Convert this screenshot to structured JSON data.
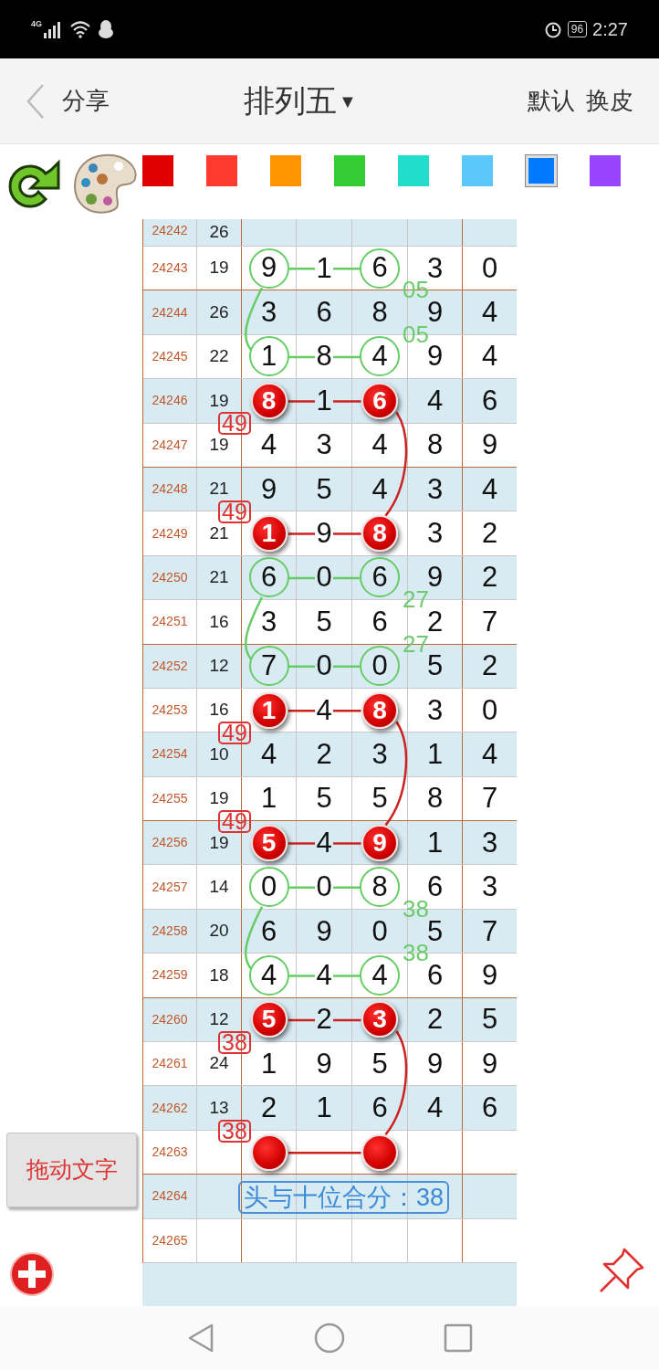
{
  "status_bar": {
    "network": "4G",
    "battery": "96",
    "time": "2:27"
  },
  "header": {
    "back_label": "分享",
    "title": "排列五",
    "title_caret": "▼",
    "actions": [
      "默认",
      "换皮"
    ]
  },
  "palette": {
    "swatches": [
      {
        "color": "#e00000",
        "selected": false
      },
      {
        "color": "#ff3b30",
        "selected": false
      },
      {
        "color": "#ff9500",
        "selected": false
      },
      {
        "color": "#33cc33",
        "selected": false
      },
      {
        "color": "#22ddcc",
        "selected": false
      },
      {
        "color": "#5ac8fa",
        "selected": false
      },
      {
        "color": "#007aff",
        "selected": true
      },
      {
        "color": "#9944ff",
        "selected": false
      }
    ]
  },
  "table": {
    "clipped_row": {
      "issue": "24242",
      "sum": "26"
    },
    "rows": [
      {
        "kind": "ring",
        "issue": "24243",
        "sum": "19",
        "digits": [
          {
            "v": "9",
            "marked": true
          },
          {
            "v": "1",
            "marked": false
          },
          {
            "v": "6",
            "marked": true
          },
          {
            "v": "3",
            "marked": false
          },
          {
            "v": "0",
            "marked": false
          }
        ],
        "tag": {
          "kind": "green_text",
          "text": "05"
        }
      },
      {
        "kind": "plain",
        "issue": "24244",
        "sum": "26",
        "digits": [
          {
            "v": "3",
            "marked": false
          },
          {
            "v": "6",
            "marked": false
          },
          {
            "v": "8",
            "marked": false
          },
          {
            "v": "9",
            "marked": false
          },
          {
            "v": "4",
            "marked": false
          }
        ],
        "tag": {
          "kind": "green_text",
          "text": "05"
        }
      },
      {
        "kind": "ring",
        "issue": "24245",
        "sum": "22",
        "digits": [
          {
            "v": "1",
            "marked": true
          },
          {
            "v": "8",
            "marked": false
          },
          {
            "v": "4",
            "marked": true
          },
          {
            "v": "9",
            "marked": false
          },
          {
            "v": "4",
            "marked": false
          }
        ]
      },
      {
        "kind": "ball",
        "issue": "24246",
        "sum": "19",
        "digits": [
          {
            "v": "8",
            "marked": true
          },
          {
            "v": "1",
            "marked": false
          },
          {
            "v": "6",
            "marked": true
          },
          {
            "v": "4",
            "marked": false
          },
          {
            "v": "6",
            "marked": false
          }
        ]
      },
      {
        "kind": "plain",
        "issue": "24247",
        "sum": "19",
        "digits": [
          {
            "v": "4",
            "marked": false
          },
          {
            "v": "3",
            "marked": false
          },
          {
            "v": "4",
            "marked": false
          },
          {
            "v": "8",
            "marked": false
          },
          {
            "v": "9",
            "marked": false
          }
        ],
        "tag": {
          "kind": "red_box",
          "text": "49"
        }
      },
      {
        "kind": "plain",
        "issue": "24248",
        "sum": "21",
        "digits": [
          {
            "v": "9",
            "marked": false
          },
          {
            "v": "5",
            "marked": false
          },
          {
            "v": "4",
            "marked": false
          },
          {
            "v": "3",
            "marked": false
          },
          {
            "v": "4",
            "marked": false
          }
        ]
      },
      {
        "kind": "ball",
        "issue": "24249",
        "sum": "21",
        "digits": [
          {
            "v": "1",
            "marked": true
          },
          {
            "v": "9",
            "marked": false
          },
          {
            "v": "8",
            "marked": true
          },
          {
            "v": "3",
            "marked": false
          },
          {
            "v": "2",
            "marked": false
          }
        ],
        "tag": {
          "kind": "red_box",
          "text": "49"
        }
      },
      {
        "kind": "ring",
        "issue": "24250",
        "sum": "21",
        "digits": [
          {
            "v": "6",
            "marked": true
          },
          {
            "v": "0",
            "marked": false
          },
          {
            "v": "6",
            "marked": true
          },
          {
            "v": "9",
            "marked": false
          },
          {
            "v": "2",
            "marked": false
          }
        ],
        "tag": {
          "kind": "green_text",
          "text": "27"
        }
      },
      {
        "kind": "plain",
        "issue": "24251",
        "sum": "16",
        "digits": [
          {
            "v": "3",
            "marked": false
          },
          {
            "v": "5",
            "marked": false
          },
          {
            "v": "6",
            "marked": false
          },
          {
            "v": "2",
            "marked": false
          },
          {
            "v": "7",
            "marked": false
          }
        ],
        "tag": {
          "kind": "green_text",
          "text": "27"
        }
      },
      {
        "kind": "ring",
        "issue": "24252",
        "sum": "12",
        "digits": [
          {
            "v": "7",
            "marked": true
          },
          {
            "v": "0",
            "marked": false
          },
          {
            "v": "0",
            "marked": true
          },
          {
            "v": "5",
            "marked": false
          },
          {
            "v": "2",
            "marked": false
          }
        ]
      },
      {
        "kind": "ball",
        "issue": "24253",
        "sum": "16",
        "digits": [
          {
            "v": "1",
            "marked": true
          },
          {
            "v": "4",
            "marked": false
          },
          {
            "v": "8",
            "marked": true
          },
          {
            "v": "3",
            "marked": false
          },
          {
            "v": "0",
            "marked": false
          }
        ]
      },
      {
        "kind": "plain",
        "issue": "24254",
        "sum": "10",
        "digits": [
          {
            "v": "4",
            "marked": false
          },
          {
            "v": "2",
            "marked": false
          },
          {
            "v": "3",
            "marked": false
          },
          {
            "v": "1",
            "marked": false
          },
          {
            "v": "4",
            "marked": false
          }
        ],
        "tag": {
          "kind": "red_box",
          "text": "49"
        }
      },
      {
        "kind": "plain",
        "issue": "24255",
        "sum": "19",
        "digits": [
          {
            "v": "1",
            "marked": false
          },
          {
            "v": "5",
            "marked": false
          },
          {
            "v": "5",
            "marked": false
          },
          {
            "v": "8",
            "marked": false
          },
          {
            "v": "7",
            "marked": false
          }
        ]
      },
      {
        "kind": "ball",
        "issue": "24256",
        "sum": "19",
        "digits": [
          {
            "v": "5",
            "marked": true
          },
          {
            "v": "4",
            "marked": false
          },
          {
            "v": "9",
            "marked": true
          },
          {
            "v": "1",
            "marked": false
          },
          {
            "v": "3",
            "marked": false
          }
        ],
        "tag": {
          "kind": "red_box",
          "text": "49"
        }
      },
      {
        "kind": "ring",
        "issue": "24257",
        "sum": "14",
        "digits": [
          {
            "v": "0",
            "marked": true
          },
          {
            "v": "0",
            "marked": false
          },
          {
            "v": "8",
            "marked": true
          },
          {
            "v": "6",
            "marked": false
          },
          {
            "v": "3",
            "marked": false
          }
        ],
        "tag": {
          "kind": "green_text",
          "text": "38"
        }
      },
      {
        "kind": "plain",
        "issue": "24258",
        "sum": "20",
        "digits": [
          {
            "v": "6",
            "marked": false
          },
          {
            "v": "9",
            "marked": false
          },
          {
            "v": "0",
            "marked": false
          },
          {
            "v": "5",
            "marked": false
          },
          {
            "v": "7",
            "marked": false
          }
        ],
        "tag": {
          "kind": "green_text",
          "text": "38"
        }
      },
      {
        "kind": "ring",
        "issue": "24259",
        "sum": "18",
        "digits": [
          {
            "v": "4",
            "marked": true
          },
          {
            "v": "4",
            "marked": false
          },
          {
            "v": "4",
            "marked": true
          },
          {
            "v": "6",
            "marked": false
          },
          {
            "v": "9",
            "marked": false
          }
        ]
      },
      {
        "kind": "ball",
        "issue": "24260",
        "sum": "12",
        "digits": [
          {
            "v": "5",
            "marked": true
          },
          {
            "v": "2",
            "marked": false
          },
          {
            "v": "3",
            "marked": true
          },
          {
            "v": "2",
            "marked": false
          },
          {
            "v": "5",
            "marked": false
          }
        ]
      },
      {
        "kind": "plain",
        "issue": "24261",
        "sum": "24",
        "digits": [
          {
            "v": "1",
            "marked": false
          },
          {
            "v": "9",
            "marked": false
          },
          {
            "v": "5",
            "marked": false
          },
          {
            "v": "9",
            "marked": false
          },
          {
            "v": "9",
            "marked": false
          }
        ],
        "tag": {
          "kind": "red_box",
          "text": "38"
        }
      },
      {
        "kind": "plain",
        "issue": "24262",
        "sum": "13",
        "digits": [
          {
            "v": "2",
            "marked": false
          },
          {
            "v": "1",
            "marked": false
          },
          {
            "v": "6",
            "marked": false
          },
          {
            "v": "4",
            "marked": false
          },
          {
            "v": "6",
            "marked": false
          }
        ]
      },
      {
        "kind": "ball",
        "issue": "24263",
        "digits": [
          {
            "marked": true
          },
          {
            "marked": false
          },
          {
            "marked": true
          },
          {
            "marked": false
          },
          {
            "marked": false
          }
        ],
        "tag": {
          "kind": "red_box",
          "text": "38"
        }
      },
      {
        "kind": "note",
        "issue": "24264",
        "note": "头与十位合分：38"
      },
      {
        "kind": "empty",
        "issue": "24265"
      }
    ]
  },
  "drag_button": "拖动文字"
}
